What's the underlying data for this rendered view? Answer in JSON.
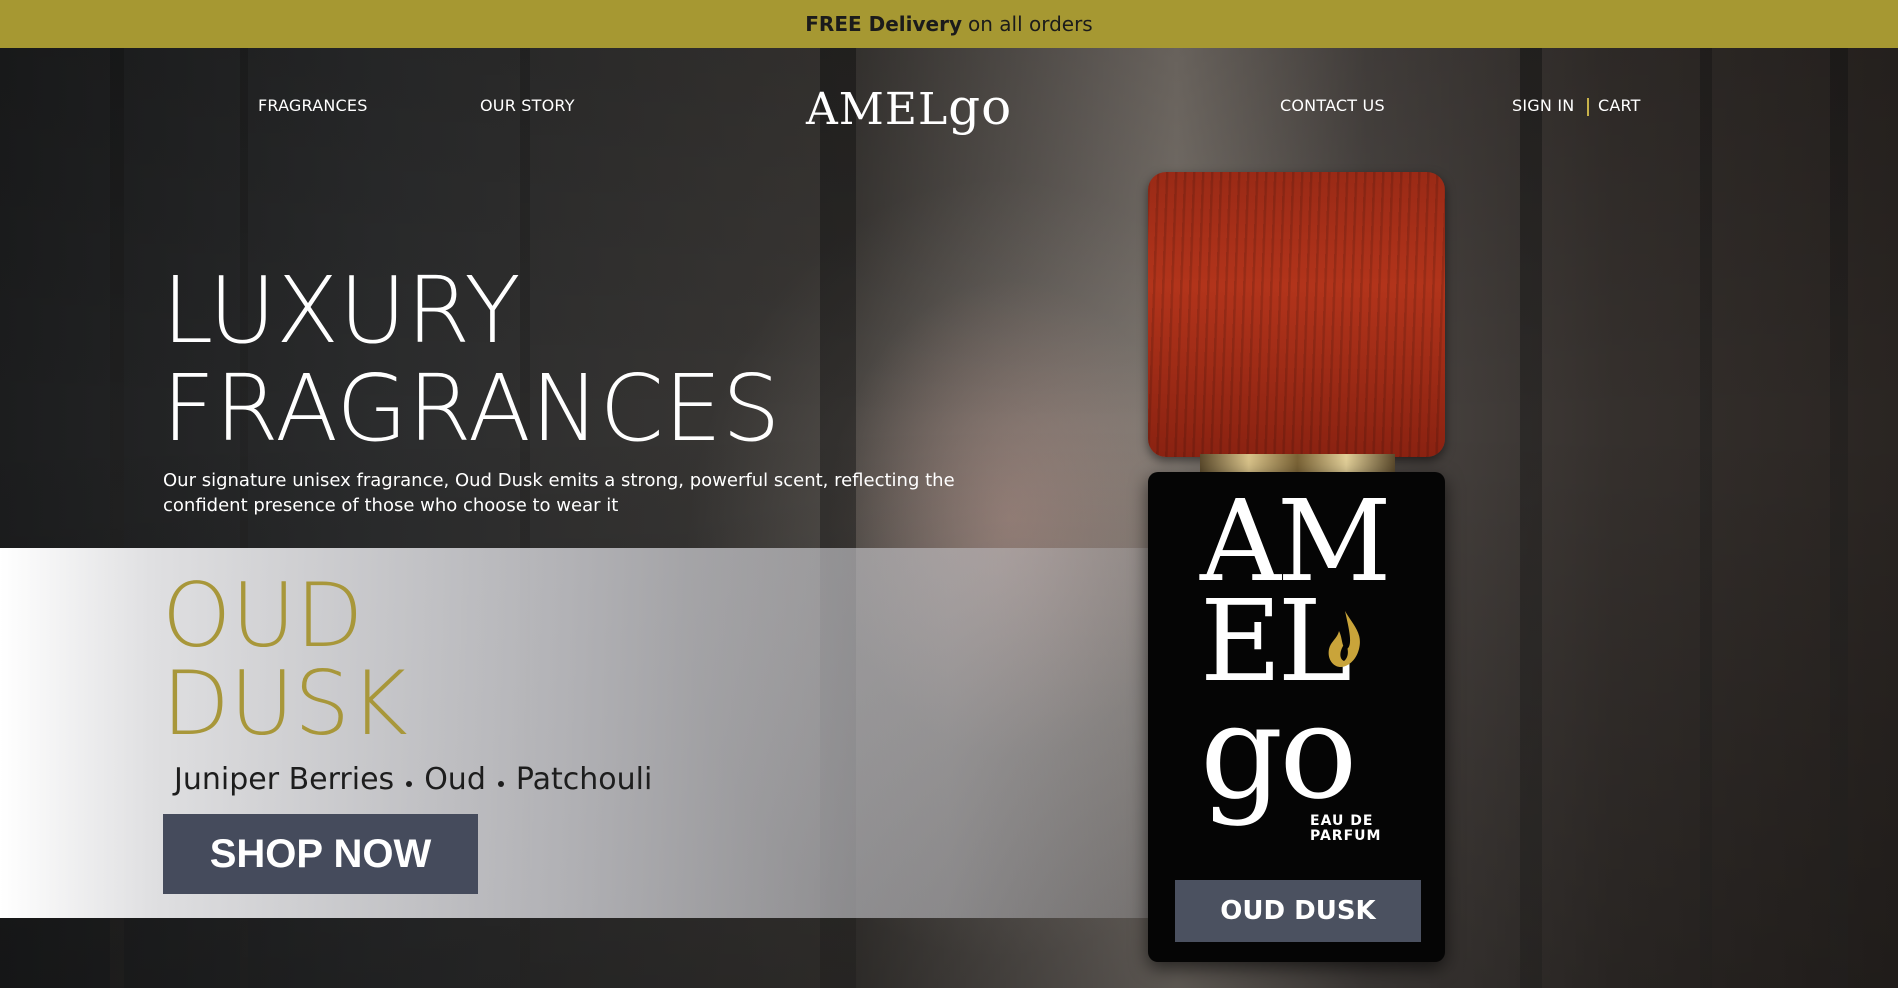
{
  "promo": {
    "bold": "FREE Delivery",
    "rest": "on all orders"
  },
  "nav": {
    "fragrances": "FRAGRANCES",
    "our_story": "OUR STORY",
    "logo_main": "AMEL",
    "logo_tail": "go",
    "contact": "CONTACT US",
    "sign_in": "SIGN IN",
    "cart": "CART"
  },
  "hero": {
    "headline_line1": "LUXURY",
    "headline_line2": "FRAGRANCES",
    "subcopy": "Our signature unisex fragrance, Oud Dusk emits a strong, powerful scent, reflecting the confident presence of those who choose to wear it"
  },
  "product": {
    "name_line1": "OUD",
    "name_line2": "DUSK",
    "notes": [
      "Juniper Berries",
      "Oud",
      "Patchouli"
    ],
    "cta": "SHOP NOW"
  },
  "bottle": {
    "logo_line1": "AM",
    "logo_line2": "EL",
    "logo_line3": "go",
    "edp_line1": "EAU DE",
    "edp_line2": "PARFUM",
    "label": "OUD DUSK"
  },
  "colors": {
    "promo_bar": "#a69832",
    "gold_text": "#a8973a",
    "cta_bg": "#454b5c",
    "cap_wood": "#b2341b"
  },
  "icons": {
    "flame": "flame-icon"
  }
}
